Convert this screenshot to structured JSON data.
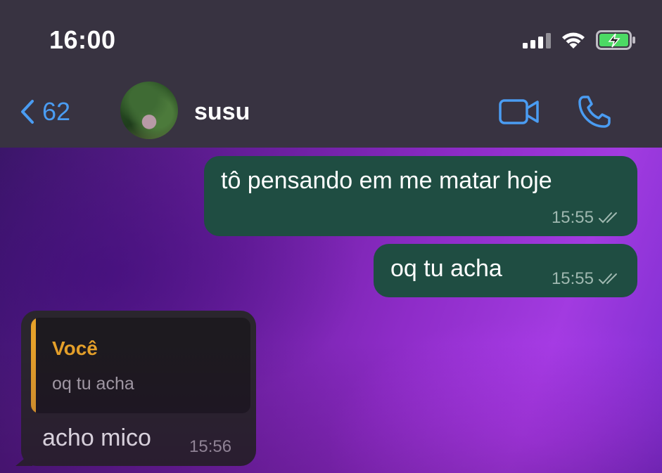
{
  "status_bar": {
    "time": "16:00",
    "icons": [
      "cellular-signal-icon",
      "wifi-icon",
      "battery-charging-icon"
    ]
  },
  "header": {
    "back_count": "62",
    "contact_name": "susu",
    "actions": [
      "video-call-icon",
      "phone-call-icon"
    ],
    "accent_color": "#4a9cf2"
  },
  "messages": [
    {
      "direction": "out",
      "text": "tô pensando em me matar hoje",
      "time": "15:55",
      "status": "read"
    },
    {
      "direction": "out",
      "text": "oq tu acha",
      "time": "15:55",
      "status": "read"
    },
    {
      "direction": "in",
      "reply_to": {
        "author": "Você",
        "text": "oq tu acha"
      },
      "text": "acho mico",
      "time": "15:56"
    }
  ],
  "colors": {
    "outgoing_bubble": "#1f4d42",
    "incoming_bubble": "#2a262d",
    "quote_accent": "#e6a12a",
    "header_bg": "#383341"
  }
}
